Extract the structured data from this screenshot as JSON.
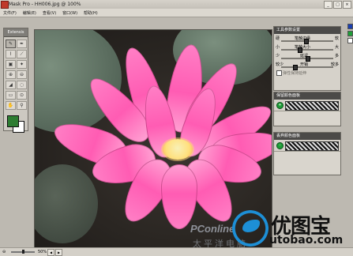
{
  "window": {
    "title": "Mask Pro - HH006.jpg @ 100%",
    "buttons": [
      "_",
      "□",
      "×"
    ]
  },
  "menu": {
    "items": [
      "文件(F)",
      "编辑(E)",
      "查看(V)",
      "窗口(W)",
      "帮助(H)"
    ]
  },
  "toolbox": {
    "title": "Extensis",
    "tools": [
      "pen-tool-icon",
      "magic-pen-icon",
      "brush-tool-icon",
      "magic-brush-icon",
      "fill-tool-icon",
      "magic-wand-icon",
      "eyedropper-keep-icon",
      "eyedropper-drop-icon",
      "chisel-tool-icon",
      "blur-tool-icon",
      "eraser-tool-icon",
      "zoom-in-icon",
      "hand-tool-icon",
      "zoom-tool-icon"
    ],
    "foreground_color": "#2e7d32",
    "background_color": "#ffffff"
  },
  "canvas": {
    "watermark": "PConline",
    "watermark_sub": "太平洋电脑"
  },
  "tool_options": {
    "title": "工具参数设置",
    "rows": [
      {
        "left": "硬",
        "center": "笔触边缘",
        "right": "软"
      },
      {
        "left": "小",
        "center": "笔触大小",
        "right": "大"
      },
      {
        "left": "少",
        "center": "延迟",
        "right": "多"
      },
      {
        "left": "较少",
        "center": "开销",
        "right": "较多"
      }
    ],
    "checkbox_label": "弹性保持延伸"
  },
  "keep_palette": {
    "title": "保留颜色面板",
    "dot_label": "+"
  },
  "drop_palette": {
    "title": "丢弃颜色面板",
    "dot_label": "-"
  },
  "statusbar": {
    "zoom_icon": "zoom-out-icon",
    "zoom_percent": "50%"
  },
  "branding": {
    "logo_text": "优图宝",
    "logo_url": "utobao.com",
    "brand_color": "#1d8fd6"
  }
}
